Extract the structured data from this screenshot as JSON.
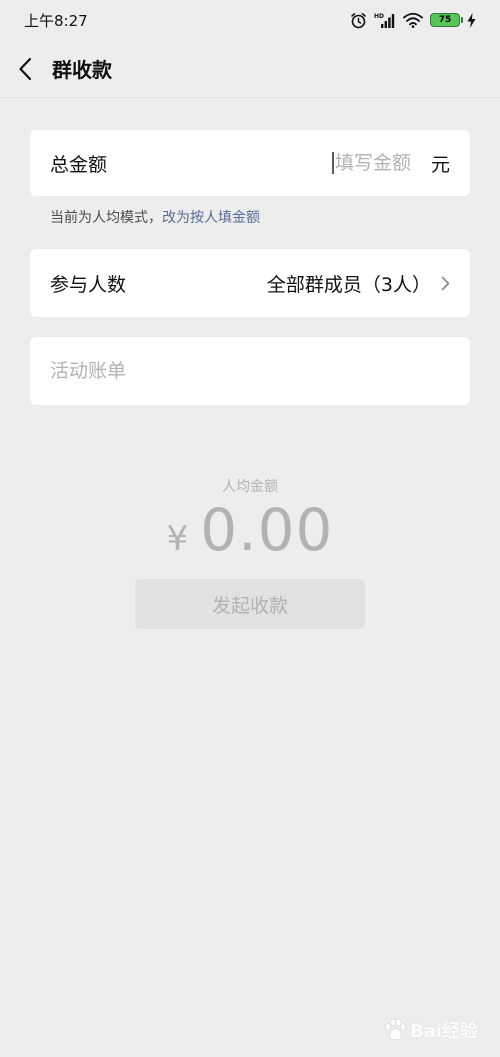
{
  "status_bar": {
    "time": "上午8:27",
    "battery_level": "75"
  },
  "nav": {
    "title": "群收款"
  },
  "total_amount": {
    "label": "总金额",
    "placeholder": "填写金额",
    "unit": "元"
  },
  "mode_hint": {
    "text": "当前为人均模式，",
    "link": "改为按人填金额"
  },
  "participants": {
    "label": "参与人数",
    "value": "全部群成员（3人）"
  },
  "activity_bill": {
    "placeholder": "活动账单"
  },
  "per_person": {
    "label": "人均金额",
    "currency": "¥",
    "value": "0.00"
  },
  "submit": {
    "label": "发起收款"
  },
  "watermark": {
    "text": "Bai经验"
  },
  "icons": {
    "back": "chevron-left-icon",
    "alarm": "alarm-icon",
    "signal": "hd-signal-icon",
    "wifi": "wifi-icon",
    "battery": "battery-icon",
    "charging": "charging-bolt-icon",
    "participants_arrow": "chevron-right-icon",
    "watermark_logo": "baidu-paw-icon"
  },
  "colors": {
    "background": "#ededed",
    "card": "#ffffff",
    "link": "#576b95",
    "disabled_text": "#b2b2b2",
    "disabled_button": "#e1e1e1",
    "battery": "#56c456"
  }
}
